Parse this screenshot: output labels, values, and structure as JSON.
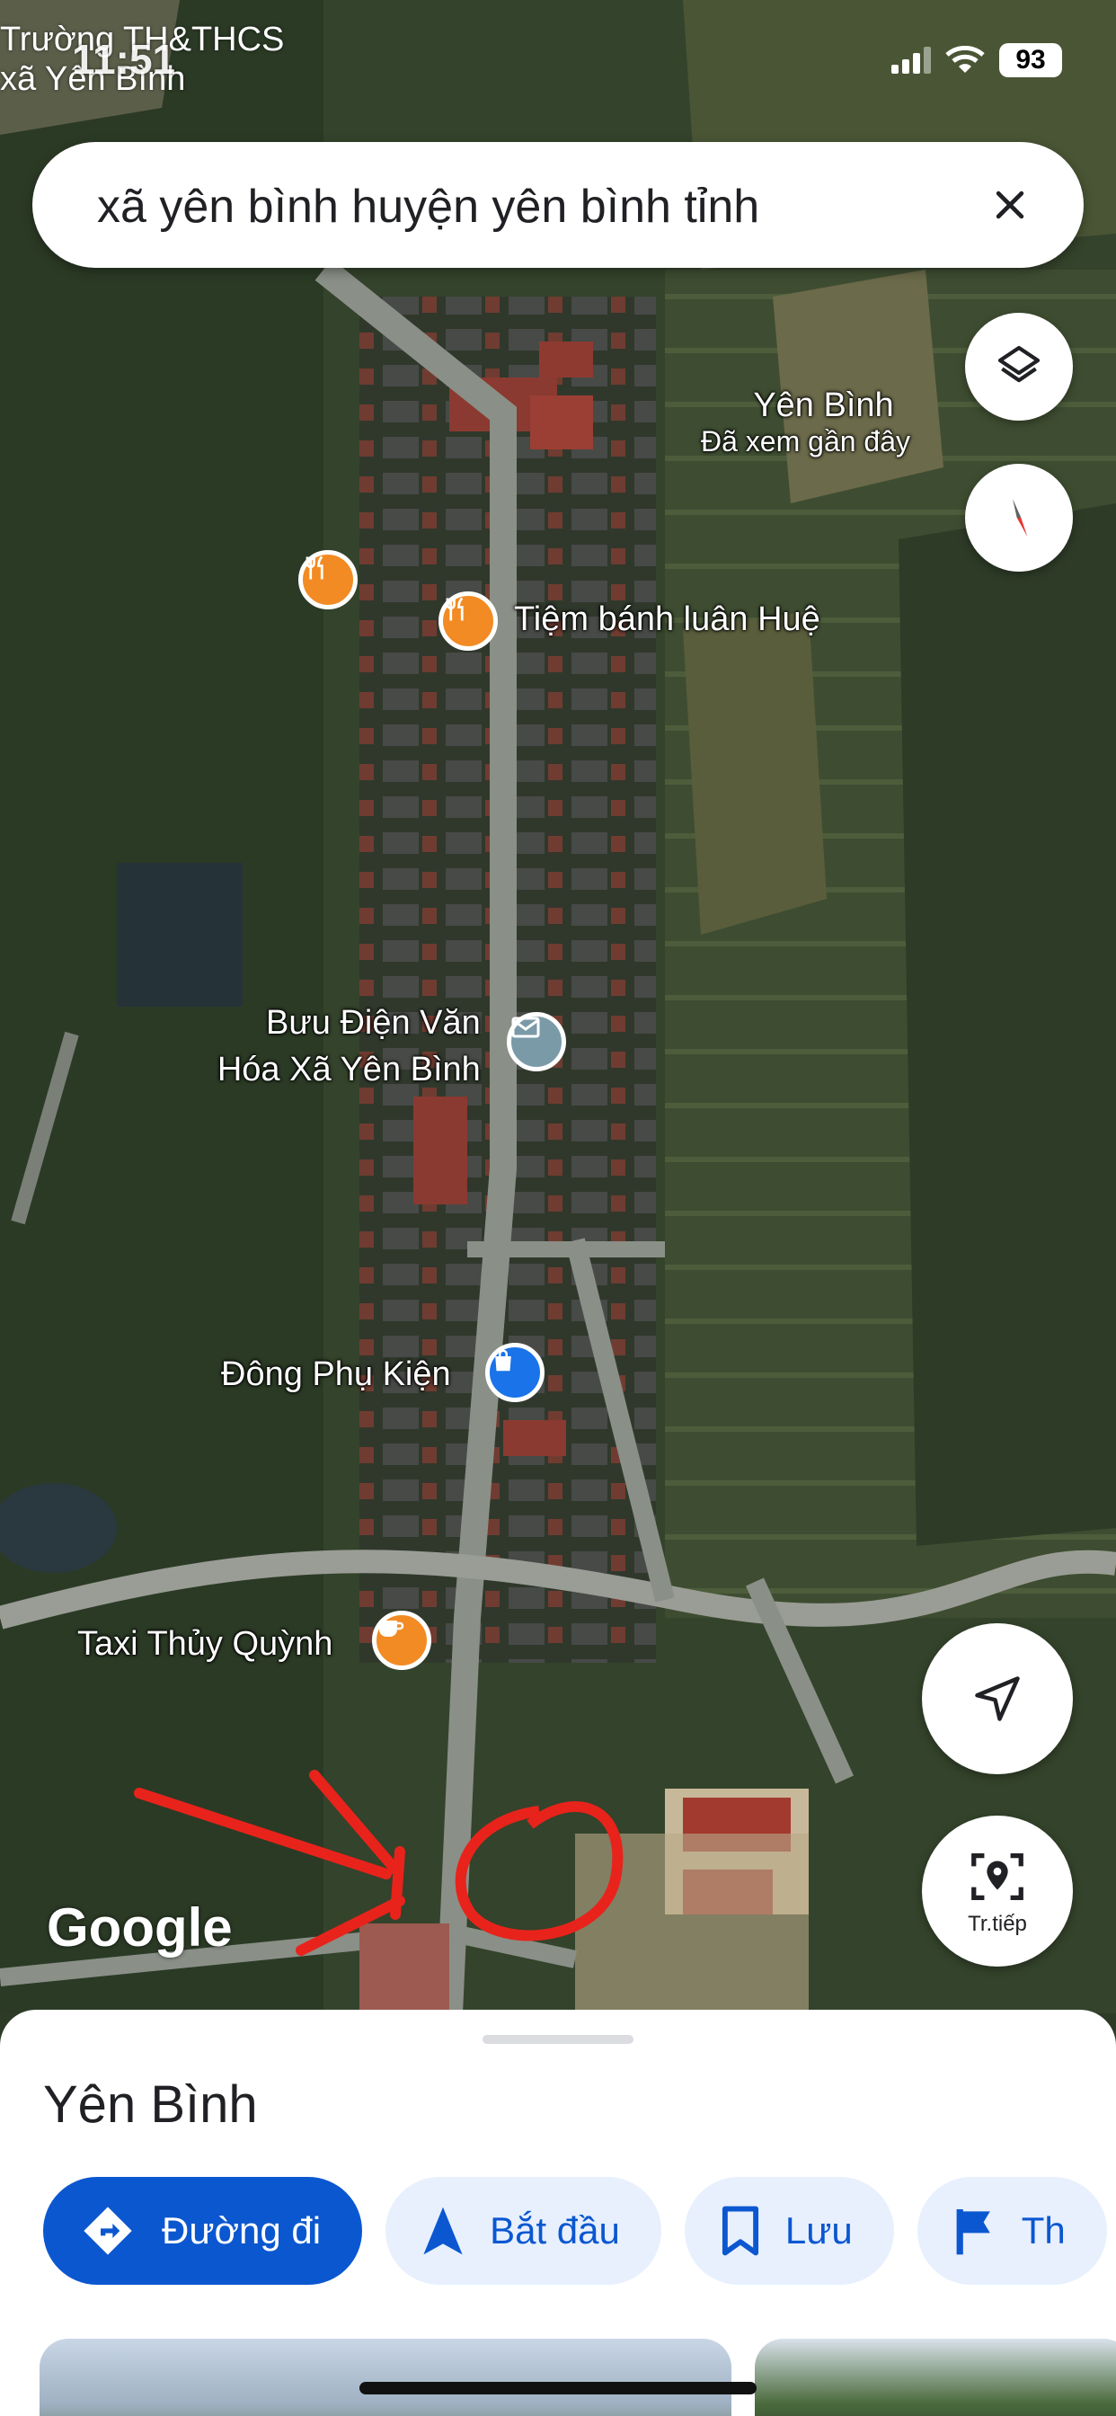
{
  "status_bar": {
    "left_text_1": "Trường TH&THCS",
    "left_text_2": "xã Yên Bình",
    "time": "11:51",
    "battery": "93"
  },
  "search": {
    "query": "xã yên bình huyện yên bình tỉnh"
  },
  "map": {
    "place_label": "Yên Bình",
    "place_sub": "Đã xem gần đây",
    "poi": [
      {
        "name": "Tiệm bánh luân Huệ",
        "type": "restaurant",
        "color": "#f28b24"
      },
      {
        "name": "Bưu Điện Văn",
        "name2": "Hóa Xã Yên Bình",
        "type": "post-office",
        "color": "#7a9aa8"
      },
      {
        "name": "Đông Phụ Kiện",
        "type": "shop",
        "color": "#1a73e8"
      },
      {
        "name": "Taxi Thủy Quỳnh",
        "type": "cafe",
        "color": "#f28b24"
      }
    ],
    "google_logo": "Google",
    "directions_fab_label": "Tr.tiếp"
  },
  "sheet": {
    "title": "Yên Bình",
    "actions": [
      {
        "label": "Đường đi",
        "icon": "directions-icon"
      },
      {
        "label": "Bắt đầu",
        "icon": "navigation-arrow-icon"
      },
      {
        "label": "Lưu",
        "icon": "bookmark-icon"
      },
      {
        "label": "Th",
        "icon": "flag-icon"
      }
    ]
  },
  "colors": {
    "accent": "#0b57d0",
    "chip_bg": "#e8f0fe",
    "annotation_red": "#e8231b"
  }
}
